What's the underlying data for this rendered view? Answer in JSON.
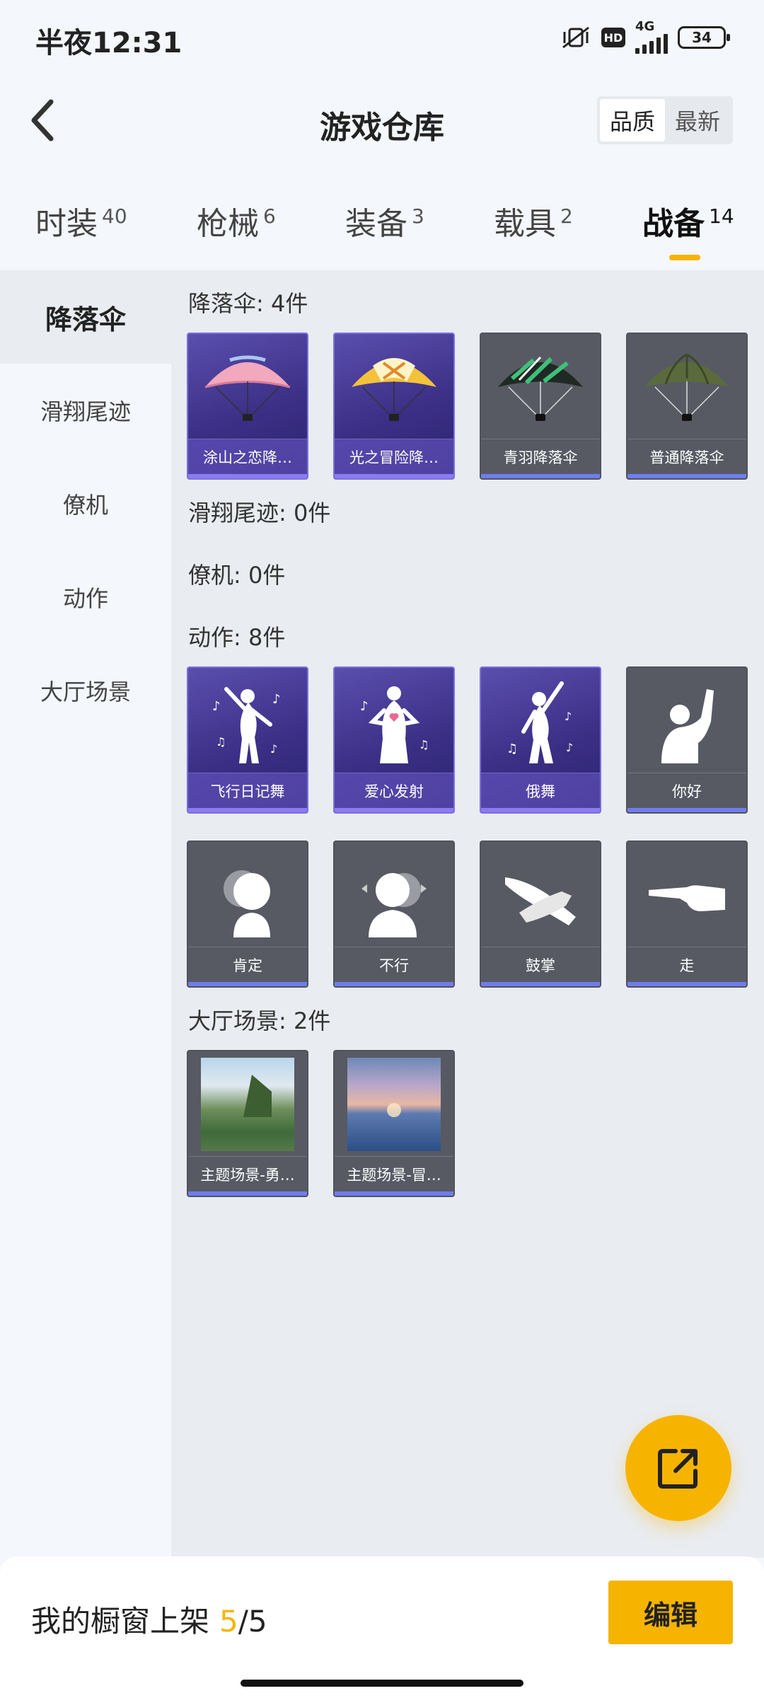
{
  "status": {
    "time": "半夜12:31",
    "hd": "HD",
    "net": "4G",
    "battery": "34"
  },
  "header": {
    "title": "游戏仓库",
    "sort_options": [
      "品质",
      "最新"
    ],
    "active_sort": "品质"
  },
  "tabs": [
    {
      "label": "时装",
      "count": "40"
    },
    {
      "label": "枪械",
      "count": "6"
    },
    {
      "label": "装备",
      "count": "3"
    },
    {
      "label": "载具",
      "count": "2"
    },
    {
      "label": "战备",
      "count": "14"
    }
  ],
  "active_tab": "战备",
  "sidebar": {
    "items": [
      "降落伞",
      "滑翔尾迹",
      "僚机",
      "动作",
      "大厅场景"
    ],
    "active": "降落伞"
  },
  "sections": {
    "parachute": {
      "title": "降落伞: 4件",
      "items": [
        "涂山之恋降…",
        "光之冒险降…",
        "青羽降落伞",
        "普通降落伞"
      ]
    },
    "trail": {
      "title": "滑翔尾迹: 0件"
    },
    "wingman": {
      "title": "僚机: 0件"
    },
    "emote": {
      "title": "动作: 8件",
      "items": [
        "飞行日记舞",
        "爱心发射",
        "俄舞",
        "你好",
        "肯定",
        "不行",
        "鼓掌",
        "走"
      ]
    },
    "lobby": {
      "title": "大厅场景: 2件",
      "items": [
        "主题场景-勇…",
        "主题场景-冒…"
      ]
    }
  },
  "bottom": {
    "label": "我的橱窗上架",
    "count": "5",
    "total": "/5",
    "edit_label": "编辑"
  },
  "colors": {
    "accent": "#f6b400",
    "purple_card": "#3b2f86",
    "gray_card": "#575a63",
    "quality_bar": "#6f7dee"
  }
}
